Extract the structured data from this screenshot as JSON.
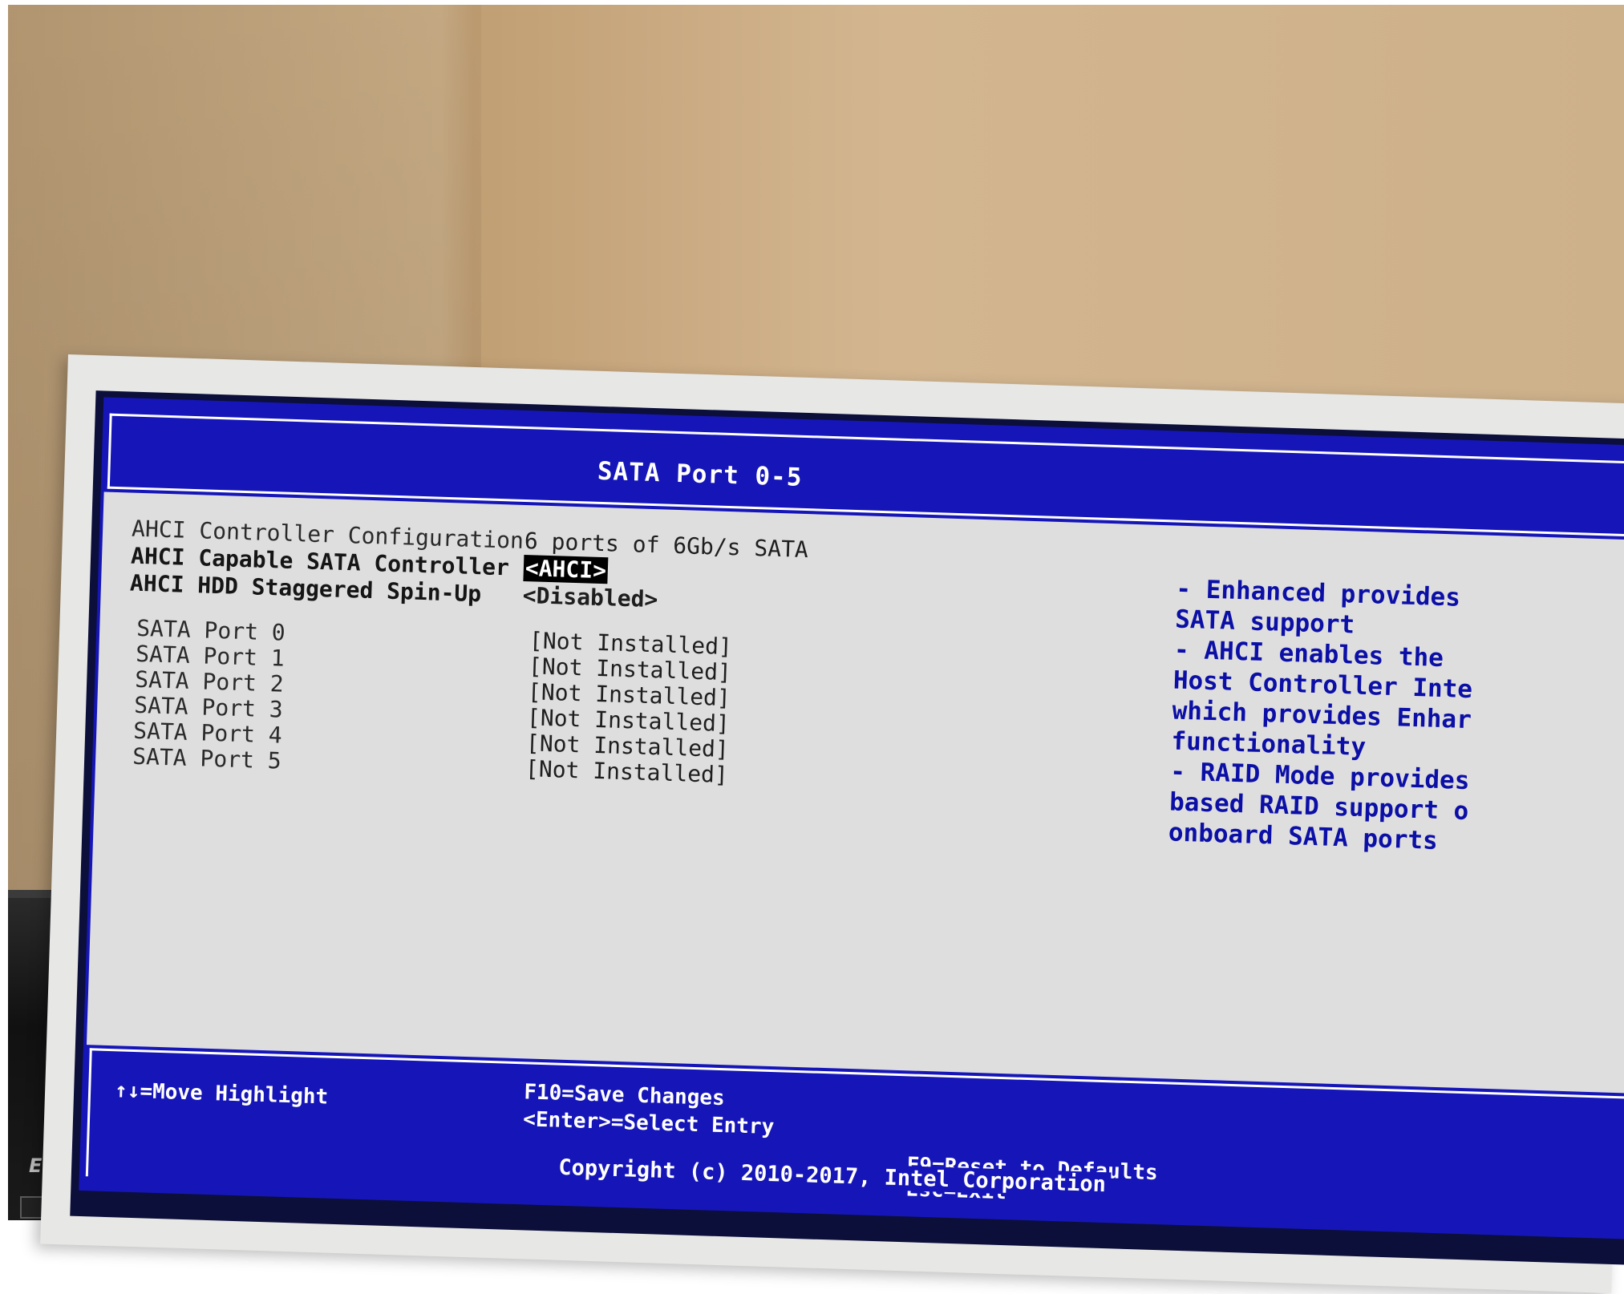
{
  "screen": {
    "title": "SATA Port 0-5"
  },
  "settings": [
    {
      "label": "AHCI Controller Configuration",
      "value": "6 ports of 6Gb/s SATA"
    },
    {
      "label": "AHCI Capable SATA Controller",
      "value": "<AHCI>"
    },
    {
      "label": "AHCI HDD Staggered Spin-Up",
      "value": "<Disabled>"
    }
  ],
  "ports": [
    {
      "label": "SATA Port 0",
      "value": "[Not Installed]"
    },
    {
      "label": "SATA Port 1",
      "value": "[Not Installed]"
    },
    {
      "label": "SATA Port 2",
      "value": "[Not Installed]"
    },
    {
      "label": "SATA Port 3",
      "value": "[Not Installed]"
    },
    {
      "label": "SATA Port 4",
      "value": "[Not Installed]"
    },
    {
      "label": "SATA Port 5",
      "value": "[Not Installed]"
    }
  ],
  "help_text": "- Enhanced provides\nSATA support\n- AHCI enables the\nHost Controller Inte\nwhich provides Enhar\nfunctionality\n- RAID Mode provides\nbased RAID support o\nonboard SATA ports",
  "footer": {
    "move": "↑↓=Move Highlight",
    "save": "F10=Save Changes",
    "select": "<Enter>=Select Entry",
    "reset": "F9=Reset to Defaults",
    "exit": "Esc=Exit",
    "copyright": "Copyright (c) 2010-2017, Intel Corporation"
  },
  "printer": {
    "brand": "EPSON"
  },
  "colors": {
    "bios_blue": "#1616b8",
    "bios_gray": "#dedede",
    "help_text": "#0b0fa6",
    "wall": "#cdb18b"
  }
}
